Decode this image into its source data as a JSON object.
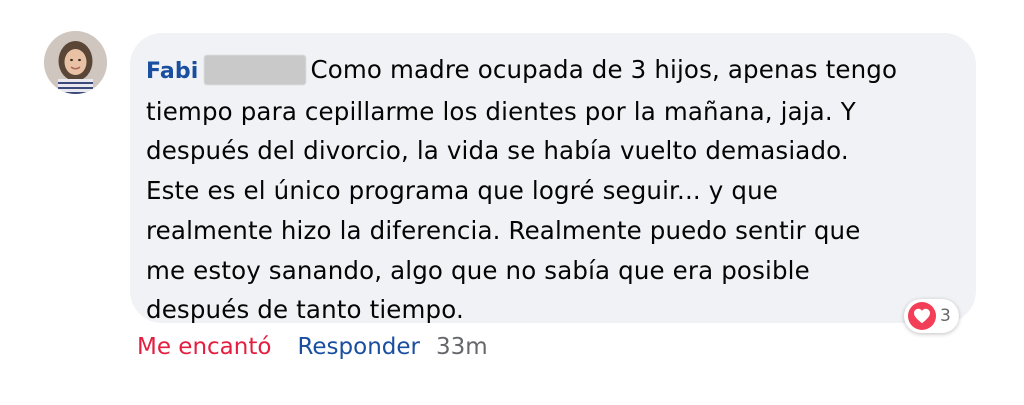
{
  "comment": {
    "author": "Fabi",
    "text_lines": [
      "Como madre ocupada de 3 hijos, apenas tengo",
      "tiempo para cepillarme los dientes por la mañana, jaja. Y",
      "después del divorcio, la vida se había vuelto demasiado.",
      "Este es el único programa que logré seguir... y que",
      "realmente hizo la diferencia. Realmente puedo sentir que",
      "me estoy sanando, algo que no sabía que era posible",
      "después de tanto tiempo."
    ],
    "reaction": {
      "icon": "heart-icon",
      "count": "3",
      "color": "#f33e58"
    }
  },
  "actions": {
    "love_label": "Me encantó",
    "reply_label": "Responder",
    "timestamp": "33m"
  },
  "colors": {
    "bubble": "#f0f2f5",
    "author": "#1a4fa0",
    "love": "#e41e3f",
    "muted": "#65676b"
  }
}
